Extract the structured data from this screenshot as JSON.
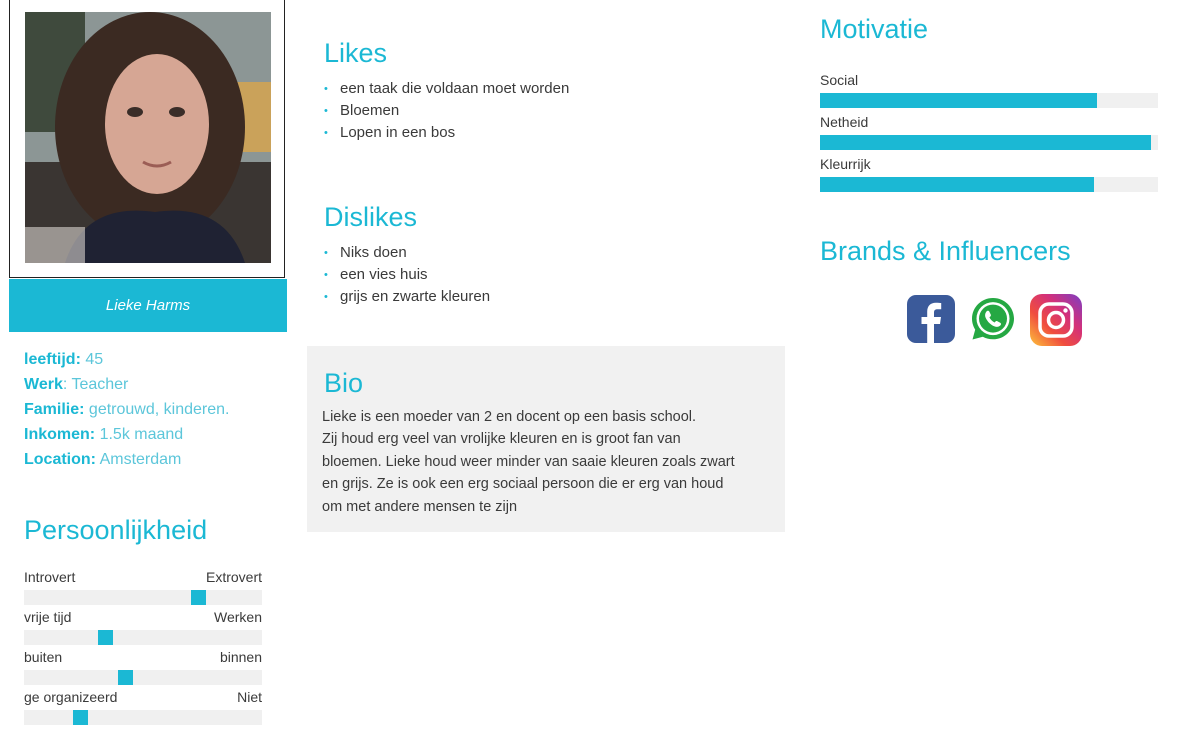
{
  "profile": {
    "name": "Lieke Harms",
    "details": [
      {
        "key": "leeftijd:",
        "value": "45"
      },
      {
        "key": "Werk",
        "sep": ":",
        "value": "Teacher"
      },
      {
        "key": "Familie:",
        "value": "getrouwd, kinderen."
      },
      {
        "key": "Inkomen:",
        "value": "1.5k maand"
      },
      {
        "key": "Location:",
        "value": "Amsterdam"
      }
    ]
  },
  "personality": {
    "title": "Persoonlijkheid",
    "traits": [
      {
        "left": "Introvert",
        "right": "Extrovert",
        "level": 0.75
      },
      {
        "left": "vrije tijd",
        "right": "Werken",
        "level": 0.33
      },
      {
        "left": "buiten",
        "right": "binnen",
        "level": 0.42
      },
      {
        "left": "ge organizeerd",
        "right": "Niet",
        "level": 0.22
      }
    ]
  },
  "likes": {
    "title": "Likes",
    "items": [
      "een taak die voldaan moet worden",
      "Bloemen",
      "Lopen in een bos"
    ]
  },
  "dislikes": {
    "title": "Dislikes",
    "items": [
      "Niks doen",
      "een vies huis",
      "grijs en zwarte kleuren"
    ]
  },
  "bio": {
    "title": "Bio",
    "lines": [
      "Lieke is een moeder van 2 en docent op een basis school.",
      "Zij houd erg veel van vrolijke kleuren en is groot fan van",
      "bloemen. Lieke houd weer minder van saaie kleuren zoals zwart",
      "en grijs. Ze is ook een erg sociaal persoon die er erg van houd",
      "om met andere mensen te zijn"
    ]
  },
  "motivation": {
    "title": "Motivatie",
    "items": [
      {
        "label": "Social",
        "level": 0.82
      },
      {
        "label": "Netheid",
        "level": 0.98
      },
      {
        "label": "Kleurrijk",
        "level": 0.81
      }
    ]
  },
  "brands": {
    "title": "Brands & Influencers",
    "icons": [
      "facebook-icon",
      "whatsapp-icon",
      "instagram-icon"
    ]
  },
  "colors": {
    "accent": "#1bb8d4",
    "track": "#f0f0f0",
    "bio_bg": "#f1f1f1"
  }
}
